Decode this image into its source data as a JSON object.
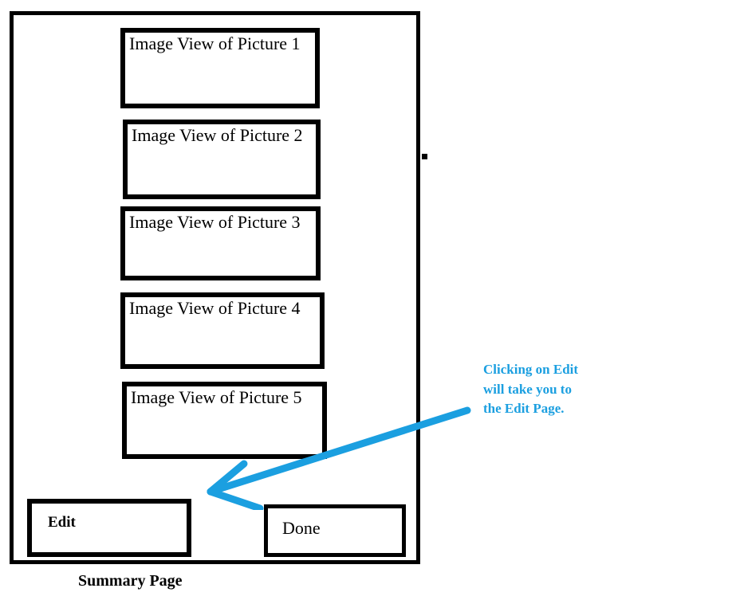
{
  "screen": {
    "caption": "Summary Page",
    "frame_border_color": "#000000",
    "background_color": "#ffffff"
  },
  "picture_list": {
    "items": [
      {
        "label": "Image View of Picture 1"
      },
      {
        "label": "Image View of Picture 2"
      },
      {
        "label": "Image View of Picture 3"
      },
      {
        "label": "Image View of Picture 4"
      },
      {
        "label": "Image View of Picture 5"
      }
    ]
  },
  "actions": {
    "edit_label": "Edit",
    "done_label": "Done"
  },
  "annotation": {
    "line1": "Clicking on Edit",
    "line2": "will take you to",
    "line3": "the Edit Page.",
    "color": "#1b9fe0",
    "arrow_points_to": "Edit"
  }
}
